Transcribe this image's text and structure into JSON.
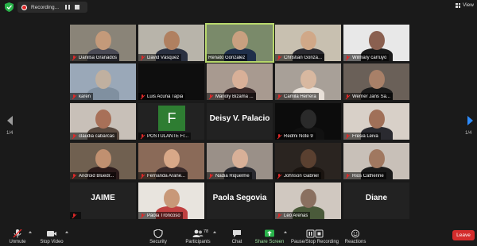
{
  "topbar": {
    "recording_label": "Recording...",
    "view_label": "View",
    "shield_icon": "shield-check-icon"
  },
  "navigation": {
    "page_left": "1/4",
    "page_right": "1/4"
  },
  "participants": [
    {
      "name": "Danilsa Granados",
      "kind": "video",
      "muted": true,
      "bg": "#8a8478",
      "skin": "#c49a7a",
      "shirt": "#4a4a55"
    },
    {
      "name": "David Vásquez",
      "kind": "video",
      "muted": true,
      "bg": "#b8b4aa",
      "skin": "#b08060",
      "shirt": "#2a3040"
    },
    {
      "name": "Renato Gonzalez",
      "kind": "video",
      "muted": false,
      "active": true,
      "bg": "#7a8a6a",
      "skin": "#c8a080",
      "shirt": "#1f2f4a"
    },
    {
      "name": "Christian Gonzá...",
      "kind": "video",
      "muted": true,
      "bg": "#c8c0b0",
      "skin": "#d0a888",
      "shirt": "#2a2a30"
    },
    {
      "name": "Wilmary carruyo",
      "kind": "video",
      "muted": true,
      "bg": "#e8e8e8",
      "skin": "#8a6050",
      "shirt": "#1a1a1a"
    },
    {
      "name": "karen",
      "kind": "video",
      "muted": true,
      "bg": "#9aa8b8",
      "skin": "#c0b0a0",
      "shirt": "#8090a0"
    },
    {
      "name": "Luis Acuña Tapia",
      "kind": "blank",
      "muted": true
    },
    {
      "name": "Marioly Bizama ...",
      "kind": "video",
      "muted": true,
      "bg": "#a89a90",
      "skin": "#d8b098",
      "shirt": "#3a2a2a"
    },
    {
      "name": "Camila Herrera",
      "kind": "video",
      "muted": true,
      "bg": "#a8a098",
      "skin": "#d8b8a0",
      "shirt": "#e8e0d8"
    },
    {
      "name": "Werner Jans Sa...",
      "kind": "video",
      "muted": true,
      "bg": "#6a6058",
      "skin": "#a88068",
      "shirt": "#1a1a1a"
    },
    {
      "name": "claudia cabarcas",
      "kind": "video",
      "muted": true,
      "bg": "#c8c0b8",
      "skin": "#a87058",
      "shirt": "#5a4a40"
    },
    {
      "name": "POSTULANTE Fr...",
      "kind": "avatar",
      "muted": true,
      "avatar_letter": "F"
    },
    {
      "name": "Deisy V. Palacio",
      "kind": "text",
      "muted": false
    },
    {
      "name": "Redmi Note 9",
      "kind": "video",
      "muted": true,
      "bg": "#0c0c0c",
      "skin": "#2a2a2a",
      "shirt": "#111111"
    },
    {
      "name": "Fresia Leiva",
      "kind": "video",
      "muted": true,
      "bg": "#d8d0c8",
      "skin": "#a07058",
      "shirt": "#2a2a30"
    },
    {
      "name": "Android Bluedr...",
      "kind": "video",
      "muted": true,
      "bg": "#706050",
      "skin": "#c09070",
      "shirt": "#2a1a1a"
    },
    {
      "name": "Fernanda Arane...",
      "kind": "video",
      "muted": true,
      "bg": "#8a6a58",
      "skin": "#d8a888",
      "shirt": "#3a2a2a"
    },
    {
      "name": "Nadia Riquelme",
      "kind": "video",
      "muted": true,
      "bg": "#9a9088",
      "skin": "#d8b098",
      "shirt": "#2a2a30"
    },
    {
      "name": "Johnson Gabriel",
      "kind": "video",
      "muted": true,
      "bg": "#2a2420",
      "skin": "#5a4030",
      "shirt": "#1a1410"
    },
    {
      "name": "Rios Catherine",
      "kind": "video",
      "muted": true,
      "bg": "#c8c0b8",
      "skin": "#a07860",
      "shirt": "#1a1a1a"
    },
    {
      "name": "JAIME",
      "kind": "text",
      "muted": true
    },
    {
      "name": "Paola Troncoso",
      "kind": "video",
      "muted": true,
      "bg": "#e8e4de",
      "skin": "#c89878",
      "shirt": "#c04040"
    },
    {
      "name": "Paola Segovia",
      "kind": "text",
      "muted": false
    },
    {
      "name": "Leo Arenas",
      "kind": "video",
      "muted": true,
      "bg": "#d0c8c0",
      "skin": "#8a7060",
      "shirt": "#4a5a3a"
    },
    {
      "name": "Diane",
      "kind": "text",
      "muted": false
    }
  ],
  "toolbar": {
    "unmute": "Unmute",
    "stop_video": "Stop Video",
    "security": "Security",
    "participants": "Participants",
    "participants_count": "78",
    "chat": "Chat",
    "share_screen": "Share Screen",
    "pause_stop_recording": "Pause/Stop Recording",
    "reactions": "Reactions",
    "leave": "Leave"
  },
  "colors": {
    "active_speaker_border": "#b8d86c",
    "share_screen_green": "#29b34a",
    "leave_red": "#d42c2c",
    "recording_red": "#e02828",
    "nav_blue": "#2d8cff"
  }
}
